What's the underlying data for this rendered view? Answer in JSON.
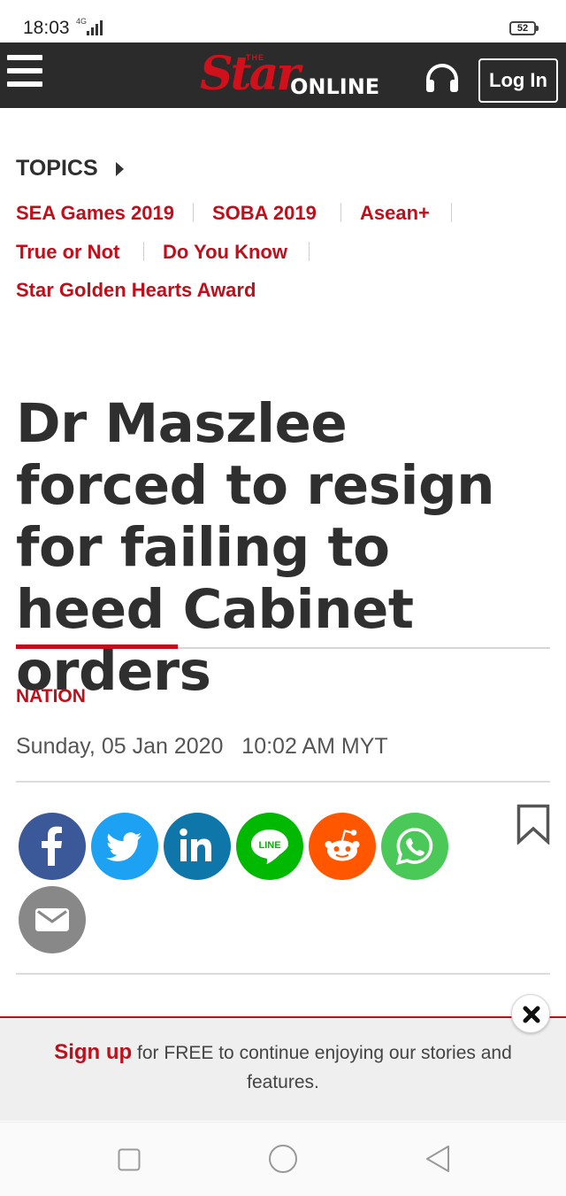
{
  "status_bar": {
    "time": "18:03",
    "network": "4G",
    "battery": "52"
  },
  "header": {
    "logo_the": "THE",
    "logo_star": "Star",
    "logo_online": "ONLINE",
    "login_label": "Log In",
    "background_color": "#2b2b2b",
    "brand_color": "#c10e1a"
  },
  "topics": {
    "heading": "TOPICS",
    "items": [
      {
        "label": "SEA Games 2019"
      },
      {
        "label": "SOBA 2019"
      },
      {
        "label": "Asean+"
      },
      {
        "label": "True or Not"
      },
      {
        "label": "Do You Know"
      },
      {
        "label": "Star Golden Hearts Award"
      }
    ]
  },
  "article": {
    "headline": "Dr Maszlee forced to resign for failing to heed Cabinet orders",
    "category": "NATION",
    "date": "Sunday, 05 Jan 2020",
    "time": "10:02 AM MYT"
  },
  "share": {
    "icons": [
      {
        "name": "facebook-icon",
        "color": "#3b5998"
      },
      {
        "name": "twitter-icon",
        "color": "#1da1f2"
      },
      {
        "name": "linkedin-icon",
        "color": "#0e76a8"
      },
      {
        "name": "line-icon",
        "color": "#00b900"
      },
      {
        "name": "reddit-icon",
        "color": "#ff5700"
      },
      {
        "name": "whatsapp-icon",
        "color": "#4ac959"
      },
      {
        "name": "email-icon",
        "color": "#888888"
      }
    ],
    "line_text": "LINE"
  },
  "banner": {
    "signup": "Sign up",
    "rest": " for FREE to continue enjoying our stories and features."
  }
}
